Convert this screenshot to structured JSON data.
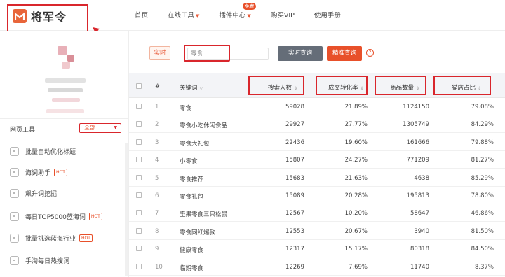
{
  "header": {
    "logo_text": "将军令",
    "nav": [
      {
        "label": "首页",
        "has_caret": false
      },
      {
        "label": "在线工具",
        "has_caret": true
      },
      {
        "label": "插件中心",
        "has_caret": true,
        "badge": "免费"
      },
      {
        "label": "购买VIP",
        "has_caret": false
      },
      {
        "label": "使用手册",
        "has_caret": false
      }
    ]
  },
  "sidebar": {
    "section_title": "网页工具",
    "filter_value": "全部",
    "tools": [
      {
        "label": "批量自动优化标题",
        "hot": ""
      },
      {
        "label": "海词助手",
        "hot": "HOT"
      },
      {
        "label": "飙升词挖掘",
        "hot": ""
      },
      {
        "label": "每日TOP5000蓝海词",
        "hot": "HOT"
      },
      {
        "label": "批量挑选蓝海行业",
        "hot": "HOT"
      },
      {
        "label": "手淘每日热搜词",
        "hot": ""
      }
    ]
  },
  "search": {
    "mode_tag": "实时",
    "query": "零食",
    "query_button": "实时查询",
    "precise_button": "精准查询",
    "help": "?"
  },
  "table": {
    "headers": {
      "rank": "#",
      "keyword": "关键词",
      "search_count": "搜索人数",
      "conversion": "成交转化率",
      "goods_count": "商品数量",
      "tmall_share": "猫店占比"
    },
    "rows": [
      {
        "rank": "1",
        "keyword": "零食",
        "search": "59028",
        "conv": "21.89%",
        "goods": "1124150",
        "share": "79.08%"
      },
      {
        "rank": "2",
        "keyword": "零食小吃休闲食品",
        "search": "29927",
        "conv": "27.77%",
        "goods": "1305749",
        "share": "84.29%"
      },
      {
        "rank": "3",
        "keyword": "零食大礼包",
        "search": "22436",
        "conv": "19.60%",
        "goods": "161666",
        "share": "79.88%"
      },
      {
        "rank": "4",
        "keyword": "小零食",
        "search": "15807",
        "conv": "24.27%",
        "goods": "771209",
        "share": "81.27%"
      },
      {
        "rank": "5",
        "keyword": "零食推荐",
        "search": "15683",
        "conv": "21.63%",
        "goods": "4638",
        "share": "85.29%"
      },
      {
        "rank": "6",
        "keyword": "零食礼包",
        "search": "15089",
        "conv": "20.28%",
        "goods": "195813",
        "share": "78.80%"
      },
      {
        "rank": "7",
        "keyword": "坚果零食三只松鼠",
        "search": "12567",
        "conv": "10.20%",
        "goods": "58647",
        "share": "46.86%"
      },
      {
        "rank": "8",
        "keyword": "零食网红爆款",
        "search": "12553",
        "conv": "20.67%",
        "goods": "3940",
        "share": "81.50%"
      },
      {
        "rank": "9",
        "keyword": "健康零食",
        "search": "12317",
        "conv": "15.17%",
        "goods": "80318",
        "share": "84.50%"
      },
      {
        "rank": "10",
        "keyword": "临期零食",
        "search": "12269",
        "conv": "7.69%",
        "goods": "11740",
        "share": "8.37%"
      }
    ]
  },
  "colors": {
    "accent": "#e8502a",
    "highlight_box": "#d9262c",
    "query_button": "#656d78"
  }
}
